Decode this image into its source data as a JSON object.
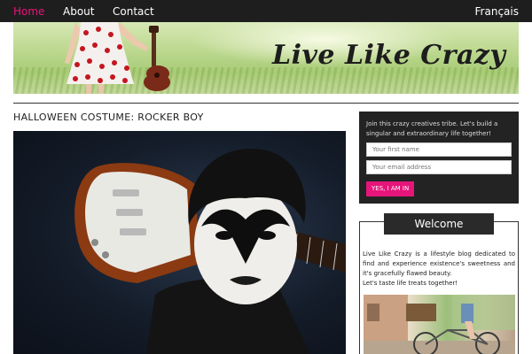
{
  "nav": {
    "items": [
      {
        "label": "Home",
        "active": true
      },
      {
        "label": "About",
        "active": false
      },
      {
        "label": "Contact",
        "active": false
      }
    ],
    "language": "Français"
  },
  "banner": {
    "title": "Live Like Crazy"
  },
  "post": {
    "title": "HALLOWEEN COSTUME: ROCKER BOY"
  },
  "signup": {
    "text": "Join this crazy creatives tribe. Let's build a singular and extraordinary life together!",
    "first_name_placeholder": "Your first name",
    "email_placeholder": "Your email address",
    "button_label": "YES, I AM IN"
  },
  "welcome": {
    "title": "Welcome",
    "text": "Live Like Crazy is a lifestyle blog dedicated to find and experience existence's sweetness and it's gracefully flawed beauty.",
    "tagline": "Let's taste life treats together!"
  },
  "colors": {
    "accent": "#e6157a",
    "nav_bg": "#1e1e1e",
    "sidebar_dark": "#232323"
  }
}
